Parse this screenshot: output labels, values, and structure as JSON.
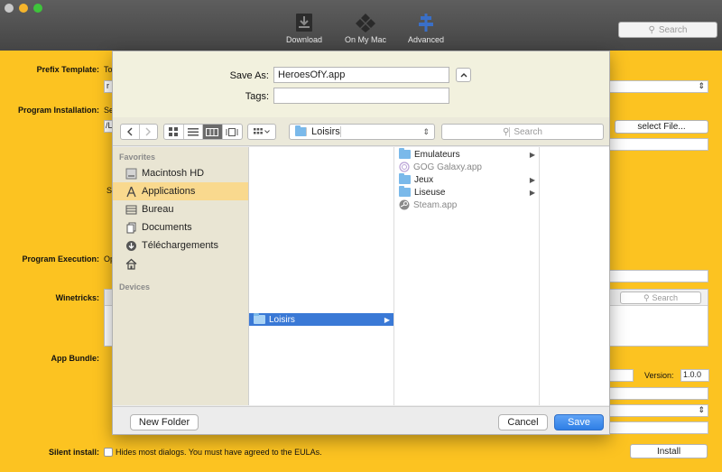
{
  "toolbar": {
    "download_label": "Download",
    "onmymac_label": "On My Mac",
    "advanced_label": "Advanced",
    "search_placeholder": "Search"
  },
  "background": {
    "prefix_template_label": "Prefix Template:",
    "prefix_template_text": "To",
    "prefix_template_select": "r",
    "program_installation_label": "Program Installation:",
    "program_installation_text": "Se",
    "program_installation_path": "/L",
    "select_file_button": "select File...",
    "s_text": "S",
    "program_execution_label": "Program Execution:",
    "program_execution_text": "Op",
    "winetricks_label": "Winetricks:",
    "winetricks_search_placeholder": "Search",
    "app_bundle_label": "App Bundle:",
    "version_label": "Version:",
    "version_value": "1.0.0",
    "silent_install_label": "Silent install:",
    "silent_install_text": "Hides most dialogs. You must have agreed to the EULAs.",
    "install_button": "Install"
  },
  "dialog": {
    "save_as_label": "Save As:",
    "save_as_value": "HeroesOfY.app",
    "tags_label": "Tags:",
    "tags_value": "",
    "location": "Loisirs",
    "search_placeholder": "Search",
    "sidebar": {
      "favorites_header": "Favorites",
      "items": [
        {
          "label": "Macintosh HD",
          "icon": "hard-drive-icon"
        },
        {
          "label": "Applications",
          "icon": "applications-icon",
          "selected": true
        },
        {
          "label": "Bureau",
          "icon": "desktop-icon"
        },
        {
          "label": "Documents",
          "icon": "documents-icon"
        },
        {
          "label": "Téléchargements",
          "icon": "downloads-icon"
        },
        {
          "label": "",
          "icon": "home-icon"
        }
      ],
      "devices_header": "Devices"
    },
    "column1": [
      {
        "label": "Loisirs",
        "folder": true,
        "selected": true
      }
    ],
    "column2": [
      {
        "label": "Emulateurs",
        "folder": true,
        "arrow": true
      },
      {
        "label": "GOG Galaxy.app",
        "folder": false,
        "arrow": false,
        "disabled": true
      },
      {
        "label": "Jeux",
        "folder": true,
        "arrow": true
      },
      {
        "label": "Liseuse",
        "folder": true,
        "arrow": true
      },
      {
        "label": "Steam.app",
        "folder": false,
        "arrow": false,
        "disabled": true
      }
    ],
    "new_folder_button": "New Folder",
    "cancel_button": "Cancel",
    "save_button": "Save"
  },
  "colors": {
    "accent": "#3d86e6",
    "background": "#fcc321",
    "selection": "#3a79d6"
  }
}
